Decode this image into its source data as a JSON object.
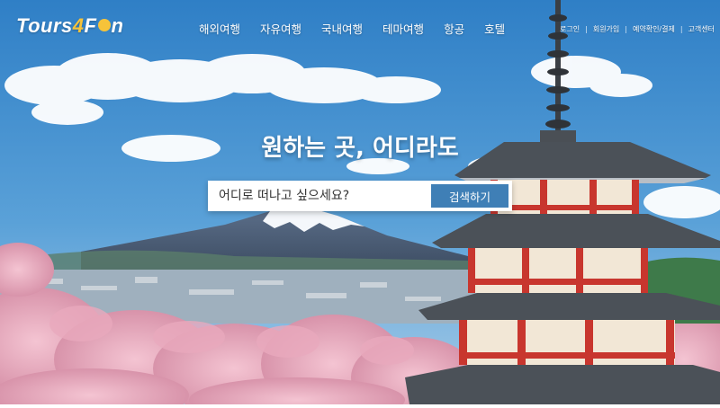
{
  "brand": {
    "logo_prefix": "Tours",
    "logo_number": "4",
    "logo_suffix_start": "F",
    "logo_suffix_end": "n"
  },
  "nav": {
    "items": [
      {
        "label": "해외여행"
      },
      {
        "label": "자유여행"
      },
      {
        "label": "국내여행"
      },
      {
        "label": "테마여행"
      },
      {
        "label": "항공"
      },
      {
        "label": "호텔"
      }
    ]
  },
  "utility": {
    "login": "로그인",
    "signup": "회원가입",
    "reservation": "예약확인/결제",
    "support": "고객센터"
  },
  "hero": {
    "headline": "원하는 곳, 어디라도",
    "search_placeholder": "어디로 떠나고 싶으세요?",
    "search_button": "검색하기"
  },
  "colors": {
    "accent": "#3f7fb6",
    "logo_highlight": "#f6c33a"
  }
}
